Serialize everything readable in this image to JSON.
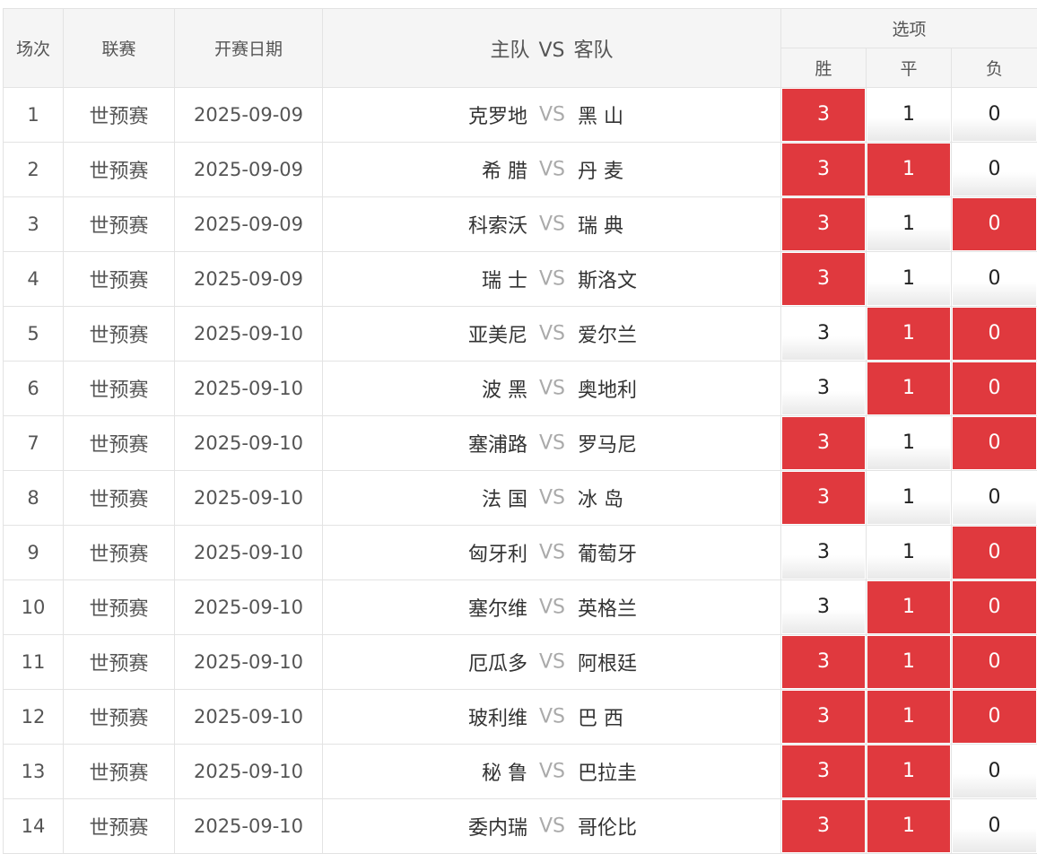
{
  "headers": {
    "match_no": "场次",
    "league": "联赛",
    "date": "开赛日期",
    "home": "主队",
    "vs": "VS",
    "away": "客队",
    "options": "选项",
    "win": "胜",
    "draw": "平",
    "lose": "负"
  },
  "colors": {
    "selected": "#e0393e",
    "header_bg": "#f5f5f5",
    "border": "#e3e3e3"
  },
  "rows": [
    {
      "no": "1",
      "league": "世预赛",
      "date": "2025-09-09",
      "home": "克罗地",
      "away": "黑 山",
      "win": "3",
      "draw": "1",
      "lose": "0",
      "win_sel": true,
      "draw_sel": false,
      "lose_sel": false
    },
    {
      "no": "2",
      "league": "世预赛",
      "date": "2025-09-09",
      "home": "希 腊",
      "away": "丹 麦",
      "win": "3",
      "draw": "1",
      "lose": "0",
      "win_sel": true,
      "draw_sel": true,
      "lose_sel": false
    },
    {
      "no": "3",
      "league": "世预赛",
      "date": "2025-09-09",
      "home": "科索沃",
      "away": "瑞 典",
      "win": "3",
      "draw": "1",
      "lose": "0",
      "win_sel": true,
      "draw_sel": false,
      "lose_sel": true
    },
    {
      "no": "4",
      "league": "世预赛",
      "date": "2025-09-09",
      "home": "瑞 士",
      "away": "斯洛文",
      "win": "3",
      "draw": "1",
      "lose": "0",
      "win_sel": true,
      "draw_sel": false,
      "lose_sel": false
    },
    {
      "no": "5",
      "league": "世预赛",
      "date": "2025-09-10",
      "home": "亚美尼",
      "away": "爱尔兰",
      "win": "3",
      "draw": "1",
      "lose": "0",
      "win_sel": false,
      "draw_sel": true,
      "lose_sel": true
    },
    {
      "no": "6",
      "league": "世预赛",
      "date": "2025-09-10",
      "home": "波 黑",
      "away": "奥地利",
      "win": "3",
      "draw": "1",
      "lose": "0",
      "win_sel": false,
      "draw_sel": true,
      "lose_sel": true
    },
    {
      "no": "7",
      "league": "世预赛",
      "date": "2025-09-10",
      "home": "塞浦路",
      "away": "罗马尼",
      "win": "3",
      "draw": "1",
      "lose": "0",
      "win_sel": true,
      "draw_sel": false,
      "lose_sel": true
    },
    {
      "no": "8",
      "league": "世预赛",
      "date": "2025-09-10",
      "home": "法 国",
      "away": "冰 岛",
      "win": "3",
      "draw": "1",
      "lose": "0",
      "win_sel": true,
      "draw_sel": false,
      "lose_sel": false
    },
    {
      "no": "9",
      "league": "世预赛",
      "date": "2025-09-10",
      "home": "匈牙利",
      "away": "葡萄牙",
      "win": "3",
      "draw": "1",
      "lose": "0",
      "win_sel": false,
      "draw_sel": false,
      "lose_sel": true
    },
    {
      "no": "10",
      "league": "世预赛",
      "date": "2025-09-10",
      "home": "塞尔维",
      "away": "英格兰",
      "win": "3",
      "draw": "1",
      "lose": "0",
      "win_sel": false,
      "draw_sel": true,
      "lose_sel": true
    },
    {
      "no": "11",
      "league": "世预赛",
      "date": "2025-09-10",
      "home": "厄瓜多",
      "away": "阿根廷",
      "win": "3",
      "draw": "1",
      "lose": "0",
      "win_sel": true,
      "draw_sel": true,
      "lose_sel": true
    },
    {
      "no": "12",
      "league": "世预赛",
      "date": "2025-09-10",
      "home": "玻利维",
      "away": "巴 西",
      "win": "3",
      "draw": "1",
      "lose": "0",
      "win_sel": true,
      "draw_sel": true,
      "lose_sel": true
    },
    {
      "no": "13",
      "league": "世预赛",
      "date": "2025-09-10",
      "home": "秘 鲁",
      "away": "巴拉圭",
      "win": "3",
      "draw": "1",
      "lose": "0",
      "win_sel": true,
      "draw_sel": true,
      "lose_sel": false
    },
    {
      "no": "14",
      "league": "世预赛",
      "date": "2025-09-10",
      "home": "委内瑞",
      "away": "哥伦比",
      "win": "3",
      "draw": "1",
      "lose": "0",
      "win_sel": true,
      "draw_sel": true,
      "lose_sel": false
    }
  ]
}
